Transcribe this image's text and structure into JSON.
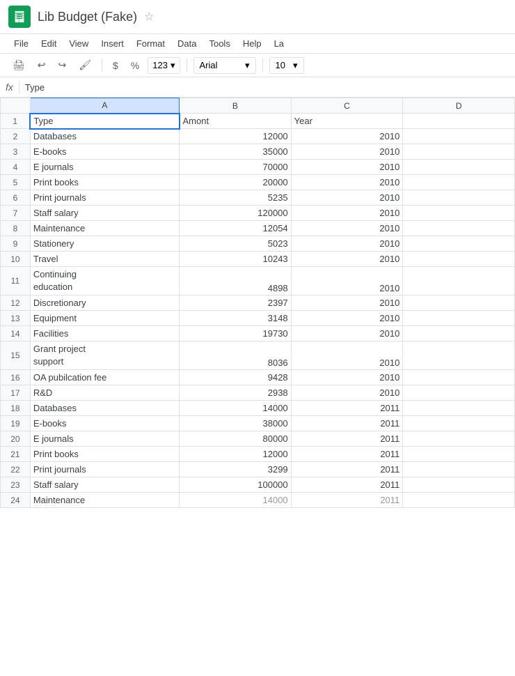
{
  "titleBar": {
    "iconAlt": "Google Sheets",
    "docTitle": "Lib Budget (Fake)",
    "starLabel": "☆"
  },
  "menuBar": {
    "items": [
      "File",
      "Edit",
      "View",
      "Insert",
      "Format",
      "Data",
      "Tools",
      "Help",
      "La"
    ]
  },
  "toolbar": {
    "printIcon": "🖨",
    "undoIcon": "↩",
    "redoIcon": "↪",
    "paintIcon": "🖌",
    "dollarLabel": "$",
    "percentLabel": "%",
    "numberFormat": "123",
    "fontName": "Arial",
    "fontSize": "10"
  },
  "formulaBar": {
    "fxLabel": "fx",
    "cellRef": "Type"
  },
  "columns": {
    "rowNum": "#",
    "a": "A",
    "b": "B",
    "c": "C",
    "d": "D"
  },
  "rows": [
    {
      "num": "1",
      "a": "Type",
      "b": "Amont",
      "c": "Year",
      "isHeader": true
    },
    {
      "num": "2",
      "a": "Databases",
      "b": "12000",
      "c": "2010"
    },
    {
      "num": "3",
      "a": "E-books",
      "b": "35000",
      "c": "2010"
    },
    {
      "num": "4",
      "a": "E journals",
      "b": "70000",
      "c": "2010"
    },
    {
      "num": "5",
      "a": "Print books",
      "b": "20000",
      "c": "2010"
    },
    {
      "num": "6",
      "a": "Print journals",
      "b": "5235",
      "c": "2010"
    },
    {
      "num": "7",
      "a": "Staff salary",
      "b": "120000",
      "c": "2010"
    },
    {
      "num": "8",
      "a": "Maintenance",
      "b": "12054",
      "c": "2010"
    },
    {
      "num": "9",
      "a": "Stationery",
      "b": "5023",
      "c": "2010"
    },
    {
      "num": "10",
      "a": "Travel",
      "b": "10243",
      "c": "2010"
    },
    {
      "num": "11",
      "a": "Continuing\neducation",
      "b": "4898",
      "c": "2010",
      "multiline": true
    },
    {
      "num": "12",
      "a": "Discretionary",
      "b": "2397",
      "c": "2010"
    },
    {
      "num": "13",
      "a": "Equipment",
      "b": "3148",
      "c": "2010"
    },
    {
      "num": "14",
      "a": "Facilities",
      "b": "19730",
      "c": "2010"
    },
    {
      "num": "15",
      "a": "Grant project\nsupport",
      "b": "8036",
      "c": "2010",
      "multiline": true
    },
    {
      "num": "16",
      "a": "OA pubilcation fee",
      "b": "9428",
      "c": "2010"
    },
    {
      "num": "17",
      "a": "R&D",
      "b": "2938",
      "c": "2010"
    },
    {
      "num": "18",
      "a": "Databases",
      "b": "14000",
      "c": "2011"
    },
    {
      "num": "19",
      "a": "E-books",
      "b": "38000",
      "c": "2011"
    },
    {
      "num": "20",
      "a": "E journals",
      "b": "80000",
      "c": "2011"
    },
    {
      "num": "21",
      "a": "Print books",
      "b": "12000",
      "c": "2011"
    },
    {
      "num": "22",
      "a": "Print journals",
      "b": "3299",
      "c": "2011"
    },
    {
      "num": "23",
      "a": "Staff salary",
      "b": "100000",
      "c": "2011"
    },
    {
      "num": "24",
      "a": "Maintenance",
      "b": "14000",
      "c": "2011",
      "partial": true
    }
  ]
}
